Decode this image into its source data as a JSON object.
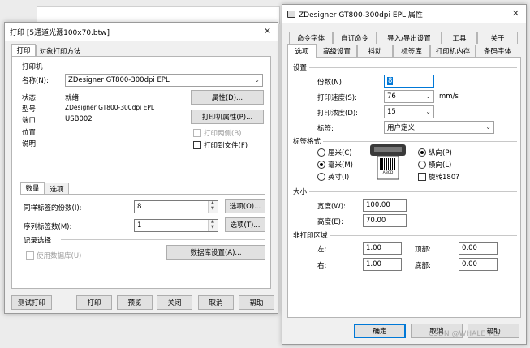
{
  "left_dialog": {
    "title": "打印 [5通道光源100x70.btw]",
    "close": "✕",
    "tabs": [
      "打印",
      "对象打印方法"
    ],
    "printer_section": "打印机",
    "name_label": "名称(N):",
    "name_value": "ZDesigner GT800-300dpi EPL",
    "status_label": "状态:",
    "status_value": "就绪",
    "type_label": "型号:",
    "type_value": "ZDesigner GT800-300dpi EPL",
    "port_label": "端口:",
    "port_value": "USB002",
    "location_label": "位置:",
    "comment_label": "说明:",
    "properties_button": "属性(D)...",
    "printer_properties_button": "打印机属性(P)...",
    "duplex_label": "打印两侧(B)",
    "print_to_file_label": "打印到文件(F)",
    "inner_tabs": [
      "数量",
      "选项"
    ],
    "identical_copies_label": "同样标签的份数(I):",
    "identical_copies_value": "8",
    "serial_labels_label": "序列标签数(M):",
    "serial_labels_value": "1",
    "options1_button": "选项(O)...",
    "options2_button": "选项(T)...",
    "record_selection": "记录选择",
    "use_database_label": "使用数据库(U)",
    "database_setup_button": "数据库设置(A)...",
    "footer_buttons": [
      "测试打印",
      "打印",
      "预览",
      "关闭",
      "取消",
      "帮助"
    ]
  },
  "right_dialog": {
    "title": "ZDesigner GT800-300dpi EPL 属性",
    "close": "✕",
    "tabs_row1": [
      "命令字体",
      "自订命令",
      "导入/导出设置",
      "工具",
      "关于"
    ],
    "tabs_row2": [
      "选项",
      "高级设置",
      "抖动",
      "标签库",
      "打印机内存",
      "条码字体"
    ],
    "settings_section": "设置",
    "copies_label": "份数(N):",
    "copies_value": "8",
    "speed_label": "打印速度(S):",
    "speed_value": "76",
    "speed_unit": "mm/s",
    "darkness_label": "打印浓度(D):",
    "darkness_value": "15",
    "stock_label": "标签:",
    "stock_value": "用户定义",
    "format_section": "标签格式",
    "unit_cm": "厘米(C)",
    "unit_mm": "毫米(M)",
    "unit_inch": "英寸(I)",
    "orient_portrait": "纵向(P)",
    "orient_landscape": "横向(L)",
    "rotate180": "旋转180?",
    "preview_text": "ABCD",
    "size_section": "大小",
    "width_label": "宽度(W):",
    "width_value": "100.00",
    "height_label": "高度(E):",
    "height_value": "70.00",
    "unprintable_section": "非打印区域",
    "left_label": "左:",
    "left_value": "1.00",
    "top_label": "顶部:",
    "top_value": "0.00",
    "right_label": "右:",
    "right_value": "1.00",
    "bottom_label": "底部:",
    "bottom_value": "0.00",
    "ok_button": "确定",
    "cancel_button": "取消",
    "help_button": "帮助"
  },
  "watermark": "CSDN @WHALE_FLY"
}
